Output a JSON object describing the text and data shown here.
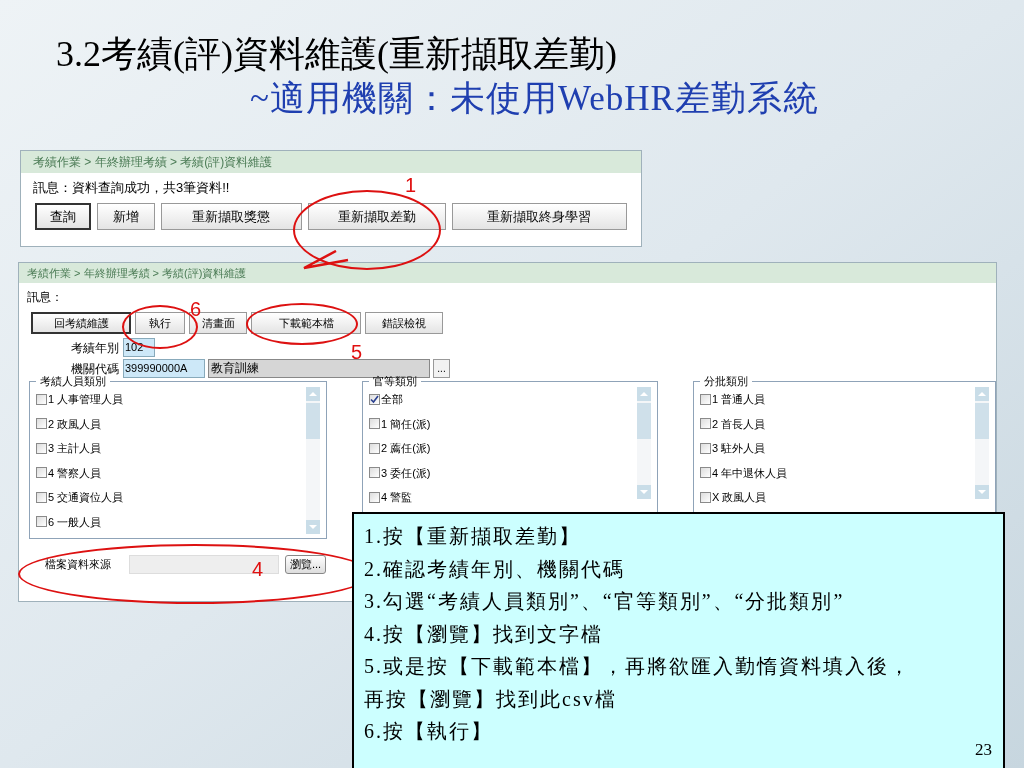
{
  "slide": {
    "title": "3.2考績(評)資料維護(重新擷取差勤)",
    "subtitle": "~適用機關：未使用WebHR差勤系統",
    "page_number": "23"
  },
  "screen_1": {
    "breadcrumb": "考績作業 > 年終辦理考績 > 考績(評)資料維護",
    "message": "訊息：資料查詢成功，共3筆資料!!",
    "buttons": [
      {
        "label": "查詢",
        "focused": true
      },
      {
        "label": "新增",
        "focused": false
      },
      {
        "label": "重新擷取獎懲",
        "focused": false
      },
      {
        "label": "重新擷取差勤",
        "focused": false
      },
      {
        "label": "重新擷取終身學習",
        "focused": false
      }
    ]
  },
  "screen_2": {
    "breadcrumb": "考績作業 > 年終辦理考績 > 考績(評)資料維護",
    "message": "訊息：",
    "buttons": [
      {
        "label": "回考績維護",
        "focused": true
      },
      {
        "label": "執行",
        "focused": false
      },
      {
        "label": "清畫面",
        "focused": false
      },
      {
        "label": "下載範本檔",
        "focused": false
      },
      {
        "label": "錯誤檢視",
        "focused": false
      }
    ],
    "year": {
      "label": "考績年別",
      "value": "102"
    },
    "agency": {
      "label": "機關代碼",
      "value": "399990000A",
      "name": "教育訓練",
      "lookup_button": "..."
    },
    "groups": [
      {
        "title": "考績人員類別",
        "items": [
          {
            "label": "1 人事管理人員",
            "checked": false
          },
          {
            "label": "2 政風人員",
            "checked": false
          },
          {
            "label": "3 主計人員",
            "checked": false
          },
          {
            "label": "4 警察人員",
            "checked": false
          },
          {
            "label": "5 交通資位人員",
            "checked": false
          },
          {
            "label": "6 一般人員",
            "checked": false
          }
        ]
      },
      {
        "title": "官等類別",
        "items": [
          {
            "label": "全部",
            "checked": true
          },
          {
            "label": "1 簡任(派)",
            "checked": false
          },
          {
            "label": "2 薦任(派)",
            "checked": false
          },
          {
            "label": "3 委任(派)",
            "checked": false
          },
          {
            "label": "4 警監",
            "checked": false
          }
        ]
      },
      {
        "title": "分批類別",
        "items": [
          {
            "label": "1 普通人員",
            "checked": false
          },
          {
            "label": "2 首長人員",
            "checked": false
          },
          {
            "label": "3 駐外人員",
            "checked": false
          },
          {
            "label": "4 年中退休人員",
            "checked": false
          },
          {
            "label": "X 政風人員",
            "checked": false
          }
        ]
      }
    ],
    "file_source": {
      "label": "檔案資料來源",
      "button": "瀏覽..."
    }
  },
  "annotations": [
    {
      "label": "1"
    },
    {
      "label": "6"
    },
    {
      "label": "5"
    },
    {
      "label": "4"
    }
  ],
  "instructions": [
    "1.按【重新擷取差勤】",
    "2.確認考績年別、機關代碼",
    "3.勾選“考績人員類別”、“官等類別”、“分批類別”",
    "4.按【瀏覽】找到文字檔",
    "5.或是按【下載範本檔】，再將欲匯入勤惰資料填入後，",
    "再按【瀏覽】找到此csv檔",
    "6.按【執行】"
  ]
}
